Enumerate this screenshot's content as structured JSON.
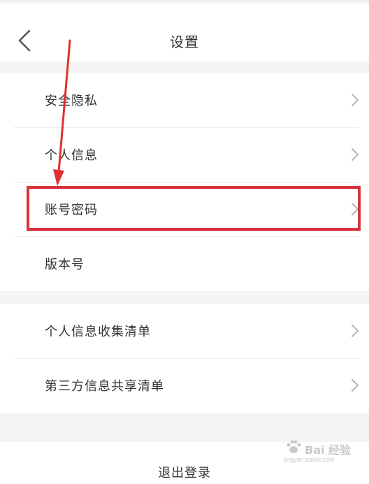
{
  "header": {
    "title": "设置",
    "back_icon": "chevron-left-icon"
  },
  "settings": {
    "group1": [
      {
        "label": "安全隐私",
        "has_chevron": true
      },
      {
        "label": "个人信息",
        "has_chevron": true
      },
      {
        "label": "账号密码",
        "has_chevron": true,
        "highlighted": true
      },
      {
        "label": "版本号",
        "has_chevron": false
      }
    ],
    "group2": [
      {
        "label": "个人信息收集清单",
        "has_chevron": true
      },
      {
        "label": "第三方信息共享清单",
        "has_chevron": true
      }
    ]
  },
  "logout_label": "退出登录",
  "annotation": {
    "highlight_color": "#d8333d",
    "arrow_color": "#e0302f"
  },
  "watermark": {
    "text": "Bai 经验",
    "sub": "jingyan.baidu.com"
  }
}
